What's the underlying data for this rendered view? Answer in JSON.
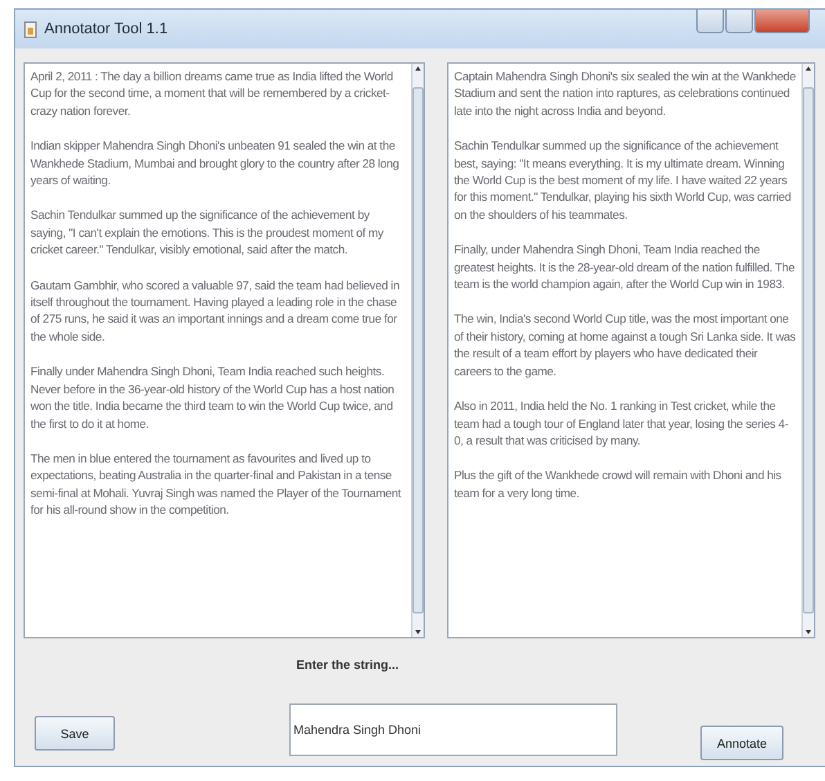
{
  "window": {
    "title": "Annotator Tool 1.1"
  },
  "panes": [
    {
      "paragraphs": [
        "April 2, 2011 : The day a billion dreams came true as India lifted the World Cup for the second time, a moment that will be remembered by a cricket-crazy nation forever.",
        "Indian skipper Mahendra Singh Dhoni's unbeaten 91 sealed the win at the Wankhede Stadium, Mumbai and brought glory to the country after 28 long years of waiting.",
        "Sachin Tendulkar summed up the significance of the achievement by saying, \"I can't explain the emotions. This is the proudest moment of my cricket career.\" Tendulkar, visibly emotional, said after the match.",
        "Gautam Gambhir, who scored a valuable 97, said the team had believed in itself throughout the tournament. Having played a leading role in the chase of 275 runs, he said it was an important innings and a dream come true for the whole side.",
        "Finally under Mahendra Singh Dhoni, Team India reached such heights. Never before in the 36-year-old history of the World Cup has a host nation won the title. India became the third team to win the World Cup twice, and the first to do it at home.",
        "The men in blue entered the tournament as favourites and lived up to expectations, beating Australia in the quarter-final and Pakistan in a tense semi-final at Mohali. Yuvraj Singh was named the Player of the Tournament for his all-round show in the competition."
      ]
    },
    {
      "paragraphs": [
        "Captain Mahendra Singh Dhoni's six sealed the win at the Wankhede Stadium and sent the nation into raptures, as celebrations continued late into the night across India and beyond.",
        "Sachin Tendulkar summed up the significance of the achievement best, saying: \"It means everything. It is my ultimate dream. Winning the World Cup is the best moment of my life. I have waited 22 years for this moment.\" Tendulkar, playing his sixth World Cup, was carried on the shoulders of his teammates.",
        "Finally, under Mahendra Singh Dhoni, Team India reached the greatest heights. It is the 28-year-old dream of the nation fulfilled. The team is the world champion again, after the World Cup win in 1983.",
        "The win, India's second World Cup title, was the most important one of their history, coming at home against a tough Sri Lanka side. It was the result of a team effort by players who have dedicated their careers to the game.",
        "Also in 2011, India held the No. 1 ranking in Test cricket, while the team had a tough tour of England later that year, losing the series 4-0, a result that was criticised by many.",
        "Plus the gift of the Wankhede crowd will remain with Dhoni and his team for a very long time."
      ]
    }
  ],
  "search": {
    "label": "Enter the string...",
    "value": "Mahendra Singh Dhoni"
  },
  "buttons": [
    {
      "label": "Save"
    },
    {
      "label": "Annotate"
    }
  ]
}
